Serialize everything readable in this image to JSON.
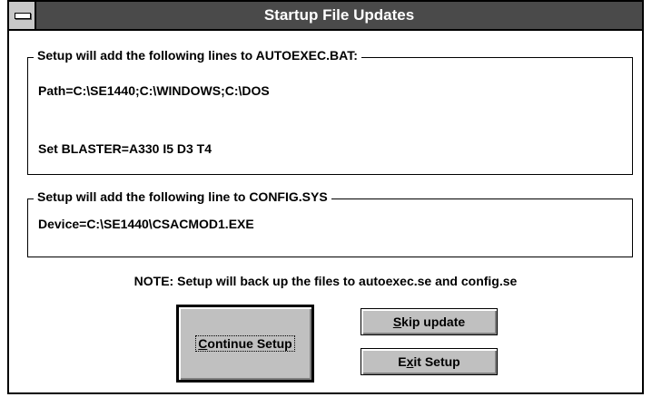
{
  "window": {
    "title": "Startup File Updates"
  },
  "autoexec_group": {
    "label": "Setup will add the following lines to AUTOEXEC.BAT:",
    "lines": [
      "Path=C:\\SE1440;C:\\WINDOWS;C:\\DOS",
      "Set BLASTER=A330 I5 D3 T4"
    ]
  },
  "config_group": {
    "label": "Setup will add the following line to CONFIG.SYS",
    "lines": [
      "Device=C:\\SE1440\\CSACMOD1.EXE"
    ]
  },
  "note": "NOTE: Setup will back up the files to autoexec.se and config.se",
  "buttons": {
    "continue": {
      "mnemonic": "C",
      "rest": "ontinue Setup"
    },
    "skip": {
      "mnemonic": "S",
      "rest": "kip update"
    },
    "exit": {
      "pre": "E",
      "mnemonic": "x",
      "rest": "it Setup"
    }
  },
  "colors": {
    "titlebar": "#4a4a4a",
    "button_face": "#c0c0c0",
    "background": "#ffffff"
  }
}
